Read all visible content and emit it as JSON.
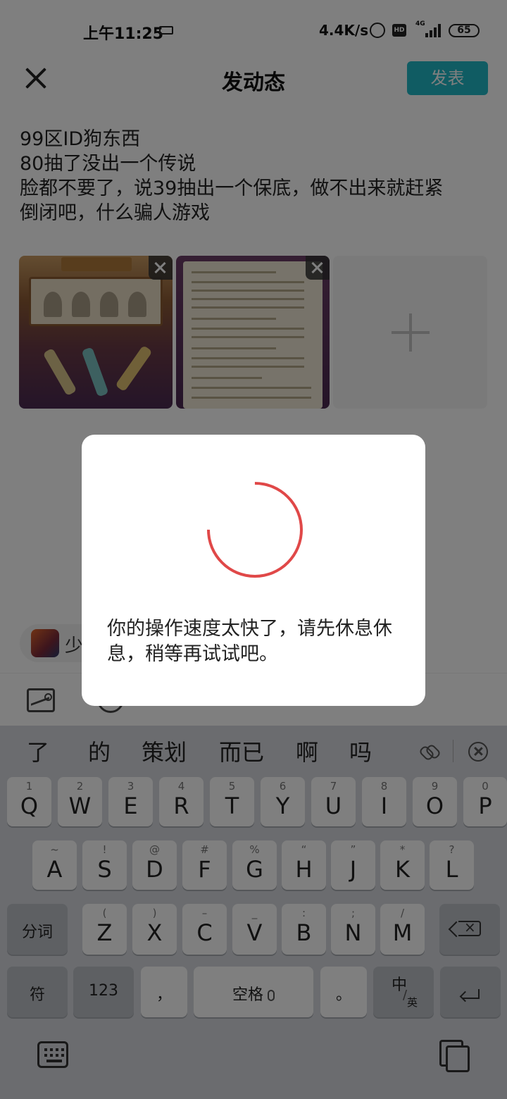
{
  "status_bar": {
    "time": "上午11:25",
    "net_speed": "4.4K/s",
    "hd_label": "HD",
    "network_type": "4G",
    "battery": "65"
  },
  "header": {
    "title": "发动态",
    "publish_label": "发表"
  },
  "post": {
    "lines": [
      "99区ID狗东西",
      "80抽了没出一个传说",
      "脸都不要了，说39抽出一个保底，做不出来就赶紧",
      "倒闭吧，什么骗人游戏"
    ]
  },
  "game_chip": {
    "name": "少"
  },
  "dialog": {
    "message": "你的操作速度太快了，请先休息休息，稍等再试试吧。",
    "spinner_color": "#e04848"
  },
  "keyboard": {
    "candidates": [
      "了",
      "的",
      "策划",
      "而已",
      "啊",
      "吗"
    ],
    "row1": [
      {
        "hint": "1",
        "key": "Q"
      },
      {
        "hint": "2",
        "key": "W"
      },
      {
        "hint": "3",
        "key": "E"
      },
      {
        "hint": "4",
        "key": "R"
      },
      {
        "hint": "5",
        "key": "T"
      },
      {
        "hint": "6",
        "key": "Y"
      },
      {
        "hint": "7",
        "key": "U"
      },
      {
        "hint": "8",
        "key": "I"
      },
      {
        "hint": "9",
        "key": "O"
      },
      {
        "hint": "0",
        "key": "P"
      }
    ],
    "row2": [
      {
        "hint": "~",
        "key": "A"
      },
      {
        "hint": "!",
        "key": "S"
      },
      {
        "hint": "@",
        "key": "D"
      },
      {
        "hint": "#",
        "key": "F"
      },
      {
        "hint": "%",
        "key": "G"
      },
      {
        "hint": "“",
        "key": "H"
      },
      {
        "hint": "”",
        "key": "J"
      },
      {
        "hint": "*",
        "key": "K"
      },
      {
        "hint": "?",
        "key": "L"
      }
    ],
    "row3": [
      {
        "hint": "(",
        "key": "Z"
      },
      {
        "hint": ")",
        "key": "X"
      },
      {
        "hint": "–",
        "key": "C"
      },
      {
        "hint": "_",
        "key": "V"
      },
      {
        "hint": ":",
        "key": "B"
      },
      {
        "hint": ";",
        "key": "N"
      },
      {
        "hint": "/",
        "key": "M"
      }
    ],
    "segment_label": "分词",
    "symbol_label": "符",
    "num_label": "123",
    "comma_label": "，",
    "space_label": "空格",
    "period_label": "。",
    "lang_cn": "中",
    "lang_en": "英"
  },
  "colors": {
    "accent": "#21b8c6",
    "overlay": "rgba(0,0,0,0.5)"
  }
}
